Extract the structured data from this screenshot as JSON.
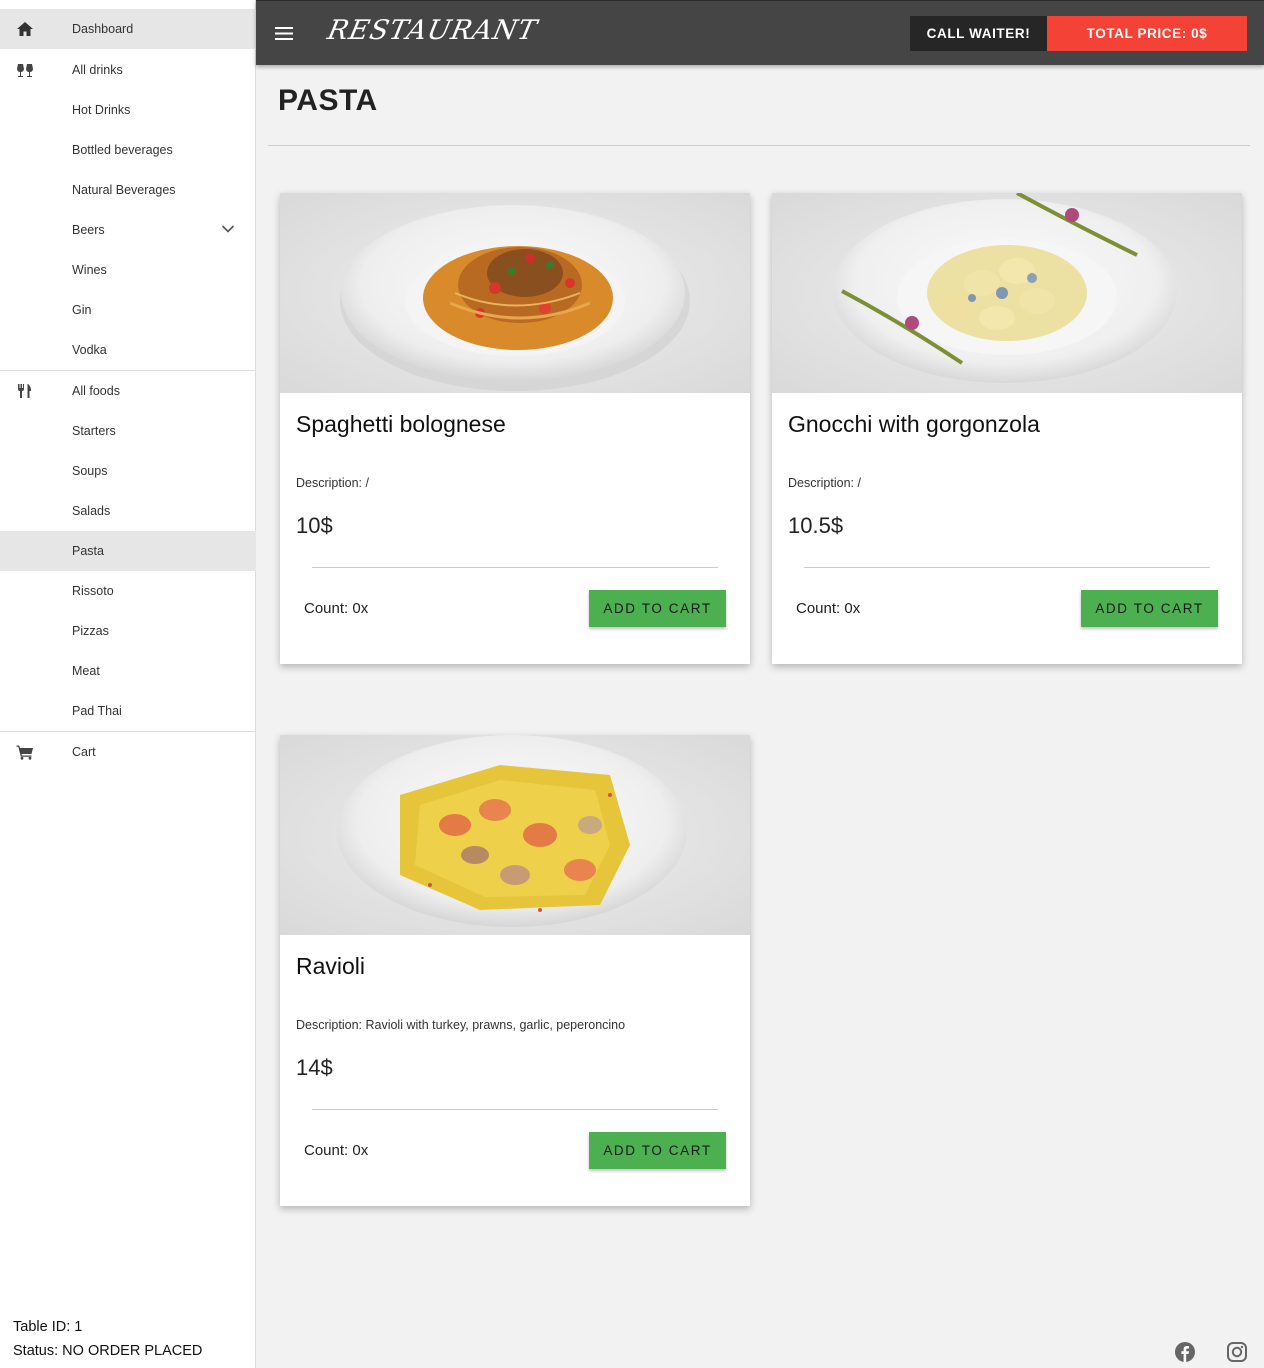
{
  "sidebar": {
    "items": [
      {
        "label": "Dashboard",
        "icon": "home-icon"
      },
      {
        "label": "All drinks",
        "icon": "glasses-icon"
      },
      {
        "label": "Hot Drinks"
      },
      {
        "label": "Bottled beverages"
      },
      {
        "label": "Natural Beverages"
      },
      {
        "label": "Beers",
        "icon": "chevron-down-icon"
      },
      {
        "label": "Wines"
      },
      {
        "label": "Gin"
      },
      {
        "label": "Vodka"
      },
      {
        "label": "All foods",
        "icon": "fork-knife-icon"
      },
      {
        "label": "Starters"
      },
      {
        "label": "Soups"
      },
      {
        "label": "Salads"
      },
      {
        "label": "Pasta"
      },
      {
        "label": "Rissoto"
      },
      {
        "label": "Pizzas"
      },
      {
        "label": "Meat"
      },
      {
        "label": "Pad Thai"
      },
      {
        "label": "Cart",
        "icon": "cart-icon"
      }
    ],
    "footer": {
      "table_id": "Table ID: 1",
      "status": "Status: NO ORDER PLACED"
    }
  },
  "header": {
    "brand": "RESTAURANT",
    "call_waiter": "CALL WAITER!",
    "total_price": "TOTAL PRICE: 0$"
  },
  "main": {
    "title": "PASTA",
    "cards": [
      {
        "name": "Spaghetti bolognese",
        "description": "Description: /",
        "price": "10$",
        "count": "Count: 0x",
        "button": "ADD TO CART"
      },
      {
        "name": "Gnocchi with gorgonzola",
        "description": "Description: /",
        "price": "10.5$",
        "count": "Count: 0x",
        "button": "ADD TO CART"
      },
      {
        "name": "Ravioli",
        "description": "Description: Ravioli with turkey, prawns, garlic, peperoncino",
        "price": "14$",
        "count": "Count: 0x",
        "button": "ADD TO CART"
      }
    ]
  },
  "colors": {
    "topbar": "#454545",
    "waiter_button": "#262626",
    "total_button": "#f44336",
    "add_button": "#4caf50",
    "active_item": "#e6e6e6"
  },
  "footer_icons": [
    "facebook-icon",
    "instagram-icon"
  ]
}
